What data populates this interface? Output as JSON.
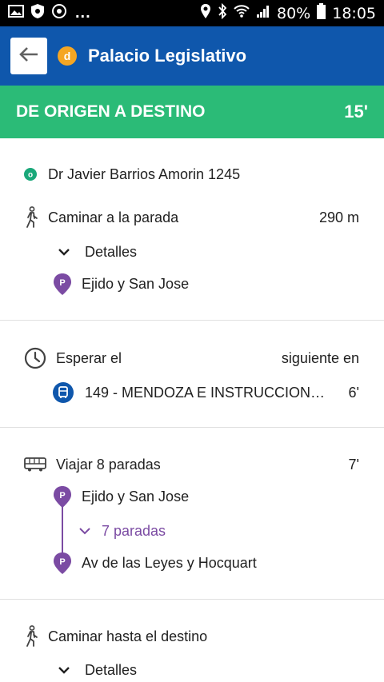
{
  "status_bar": {
    "battery": "80%",
    "time": "18:05"
  },
  "app_bar": {
    "back_icon": "arrow-left-icon",
    "dest_badge": "d",
    "title": "Palacio Legislativo"
  },
  "banner": {
    "title": "DE ORIGEN A DESTINO",
    "time": "15'"
  },
  "sections": {
    "origin": {
      "address": "Dr Javier Barrios Amorin 1245"
    },
    "walk1": {
      "label": "Caminar a la parada",
      "distance": "290 m",
      "details": "Detalles",
      "stop": "Ejido y San Jose"
    },
    "wait": {
      "label": "Esperar el",
      "right": "siguiente en",
      "route": "149 - MENDOZA E INSTRUCCION…",
      "minutes": "6'"
    },
    "ride": {
      "label": "Viajar 8 paradas",
      "minutes": "7'",
      "from_stop": "Ejido y San Jose",
      "stops_toggle": "7 paradas",
      "to_stop": "Av de las Leyes y Hocquart"
    },
    "walk2": {
      "label": "Caminar hasta el destino",
      "details": "Detalles"
    }
  },
  "colors": {
    "primary": "#0f57ac",
    "success": "#2bbb77",
    "accent": "#f5a623",
    "stop": "#7b4ba3",
    "origin": "#1aa87a"
  },
  "stop_marker_letter": "P"
}
